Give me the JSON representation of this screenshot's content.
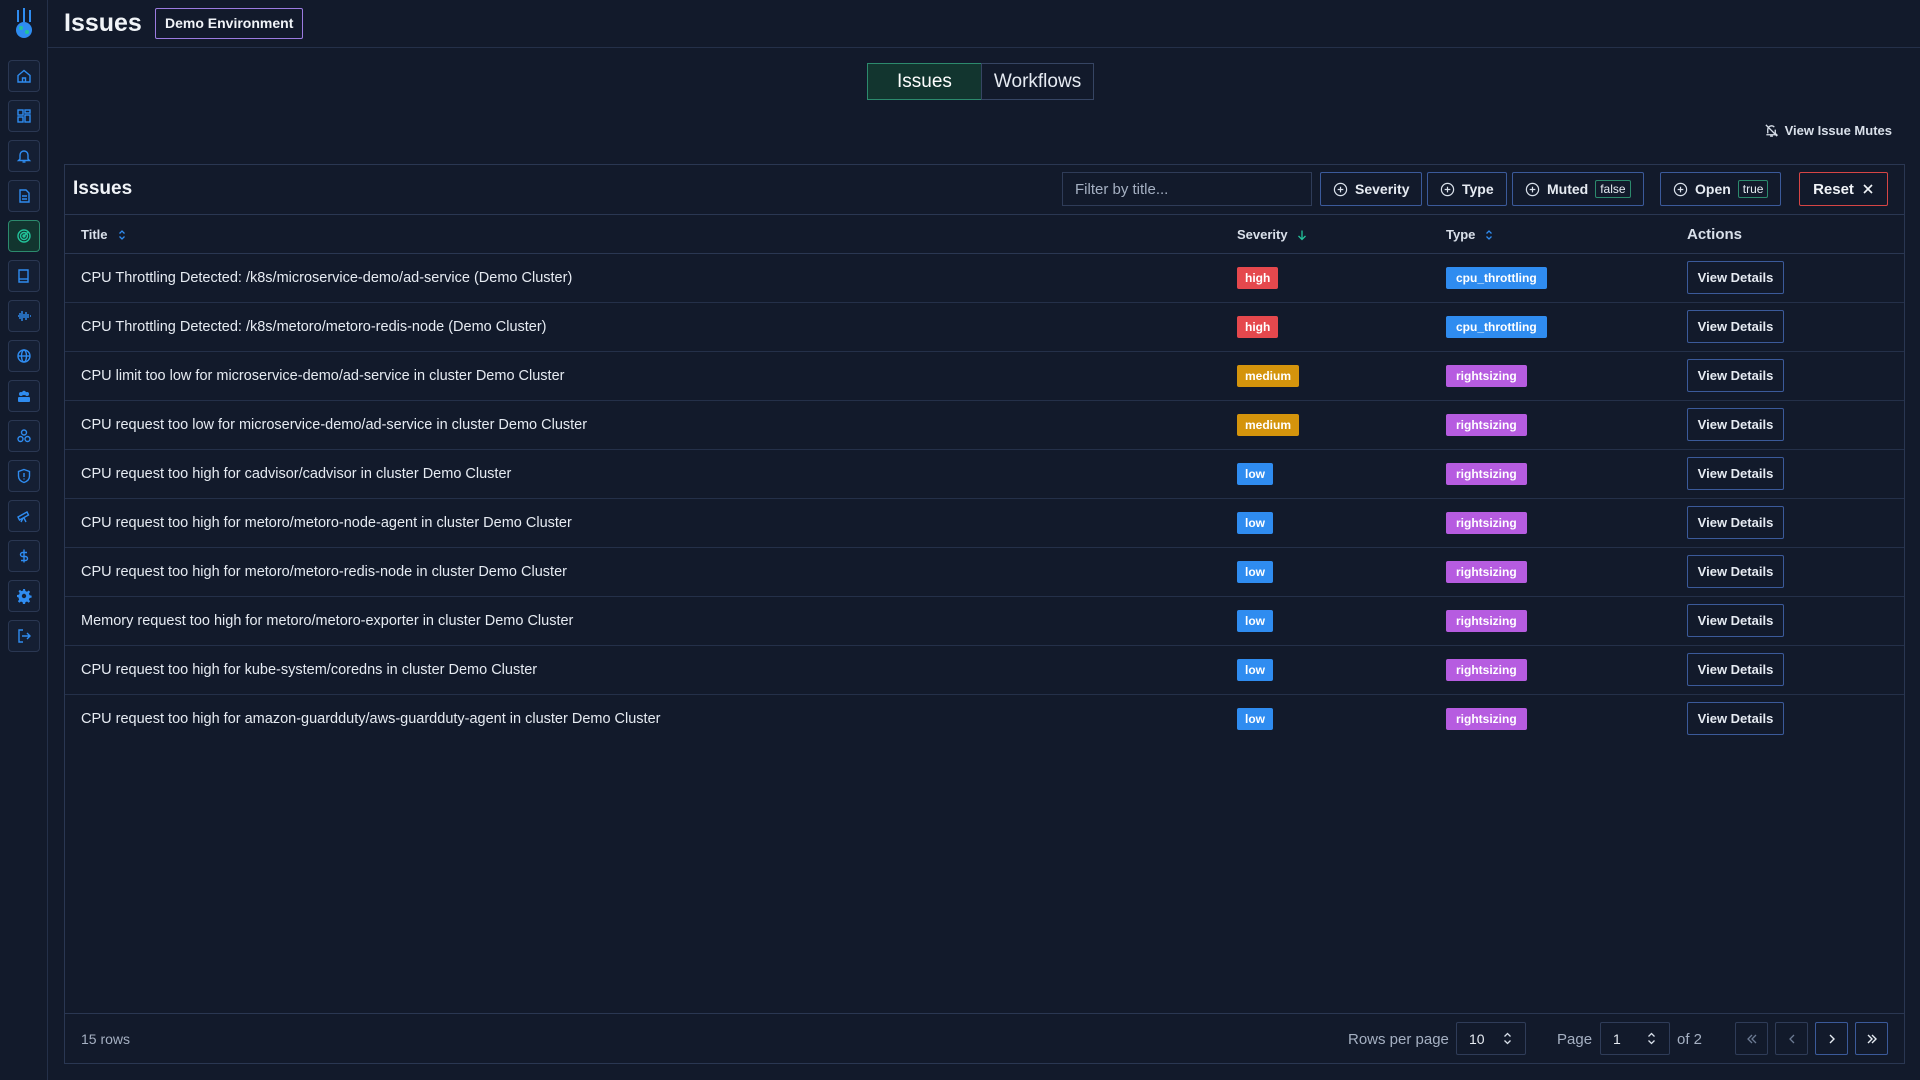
{
  "header": {
    "title": "Issues",
    "environment_badge": "Demo Environment"
  },
  "tabs": [
    {
      "label": "Issues",
      "active": true
    },
    {
      "label": "Workflows",
      "active": false
    }
  ],
  "mutes_link": "View Issue Mutes",
  "sidebar": {
    "items": [
      "home-icon",
      "dashboard-icon",
      "bell-icon",
      "document-icon",
      "radar-icon",
      "book-icon",
      "waveform-icon",
      "globe-icon",
      "team-icon",
      "cluster-icon",
      "shield-icon",
      "telescope-icon",
      "dollar-icon",
      "gear-icon",
      "logout-icon"
    ],
    "active": "radar-icon",
    "accent": "#2c8a6d"
  },
  "card": {
    "title": "Issues",
    "filter_placeholder": "Filter by title...",
    "filters": {
      "severity": "Severity",
      "type": "Type",
      "muted": "Muted",
      "muted_value": "false",
      "open": "Open",
      "open_value": "true"
    },
    "reset_label": "Reset",
    "columns": {
      "title": "Title",
      "severity": "Severity",
      "type": "Type",
      "actions": "Actions"
    },
    "view_label": "View Details",
    "rows": [
      {
        "title": "CPU Throttling Detected: /k8s/microservice-demo/ad-service (Demo Cluster)",
        "severity": "high",
        "type": "cpu_throttling"
      },
      {
        "title": "CPU Throttling Detected: /k8s/metoro/metoro-redis-node (Demo Cluster)",
        "severity": "high",
        "type": "cpu_throttling"
      },
      {
        "title": "CPU limit too low for microservice-demo/ad-service in cluster Demo Cluster",
        "severity": "medium",
        "type": "rightsizing"
      },
      {
        "title": "CPU request too low for microservice-demo/ad-service in cluster Demo Cluster",
        "severity": "medium",
        "type": "rightsizing"
      },
      {
        "title": "CPU request too high for cadvisor/cadvisor in cluster Demo Cluster",
        "severity": "low",
        "type": "rightsizing"
      },
      {
        "title": "CPU request too high for metoro/metoro-node-agent in cluster Demo Cluster",
        "severity": "low",
        "type": "rightsizing"
      },
      {
        "title": "CPU request too high for metoro/metoro-redis-node in cluster Demo Cluster",
        "severity": "low",
        "type": "rightsizing"
      },
      {
        "title": "Memory request too high for metoro/metoro-exporter in cluster Demo Cluster",
        "severity": "low",
        "type": "rightsizing"
      },
      {
        "title": "CPU request too high for kube-system/coredns in cluster Demo Cluster",
        "severity": "low",
        "type": "rightsizing"
      },
      {
        "title": "CPU request too high for amazon-guardduty/aws-guardduty-agent in cluster Demo Cluster",
        "severity": "low",
        "type": "rightsizing"
      }
    ],
    "severity_colors": {
      "high": "#e5484d",
      "medium": "#d4940c",
      "low": "#2f8cf0"
    },
    "type_colors": {
      "cpu_throttling": "#2f8cf0",
      "rightsizing": "#b65ce0"
    }
  },
  "footer": {
    "row_count": "15 rows",
    "rows_per_page_label": "Rows per page",
    "rows_per_page_value": "10",
    "page_label": "Page",
    "page_value": "1",
    "of_label": "of 2"
  }
}
